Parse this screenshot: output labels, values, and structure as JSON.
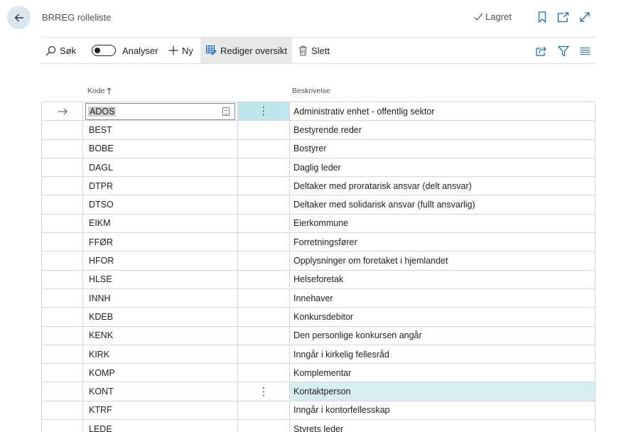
{
  "header": {
    "title": "BRREG rolleliste",
    "saved_label": "Lagret"
  },
  "toolbar": {
    "search_label": "Søk",
    "analyze_label": "Analyser",
    "new_label": "Ny",
    "edit_list_label": "Rediger oversikt",
    "delete_label": "Slett",
    "analyze_on": false
  },
  "columns": {
    "code": "Kode",
    "description": "Beskrivelse"
  },
  "rows": [
    {
      "code": "ADOS",
      "description": "Administrativ enhet - offentlig sektor"
    },
    {
      "code": "BEST",
      "description": "Bestyrende reder"
    },
    {
      "code": "BOBE",
      "description": "Bostyrer"
    },
    {
      "code": "DAGL",
      "description": "Daglig leder"
    },
    {
      "code": "DTPR",
      "description": "Deltaker med proratarisk ansvar (delt ansvar)"
    },
    {
      "code": "DTSO",
      "description": "Deltaker med solidarisk ansvar (fullt ansvarlig)"
    },
    {
      "code": "EIKM",
      "description": "Eierkommune"
    },
    {
      "code": "FFØR",
      "description": "Forretningsfører"
    },
    {
      "code": "HFOR",
      "description": "Opplysninger om foretaket i hjemlandet"
    },
    {
      "code": "HLSE",
      "description": "Helseforetak"
    },
    {
      "code": "INNH",
      "description": "Innehaver"
    },
    {
      "code": "KDEB",
      "description": "Konkursdebitor"
    },
    {
      "code": "KENK",
      "description": "Den personlige konkursen angår"
    },
    {
      "code": "KIRK",
      "description": "Inngår i kirkelig fellesråd"
    },
    {
      "code": "KOMP",
      "description": "Komplementar"
    },
    {
      "code": "KONT",
      "description": "Kontaktperson"
    },
    {
      "code": "KTRF",
      "description": "Inngår i kontorfellesskap"
    },
    {
      "code": "LEDE",
      "description": "Styrets leder"
    }
  ],
  "colors": {
    "accent": "#0f6cbd",
    "selected_cell": "#bfe6ec",
    "hover_row": "#d8eef1"
  }
}
